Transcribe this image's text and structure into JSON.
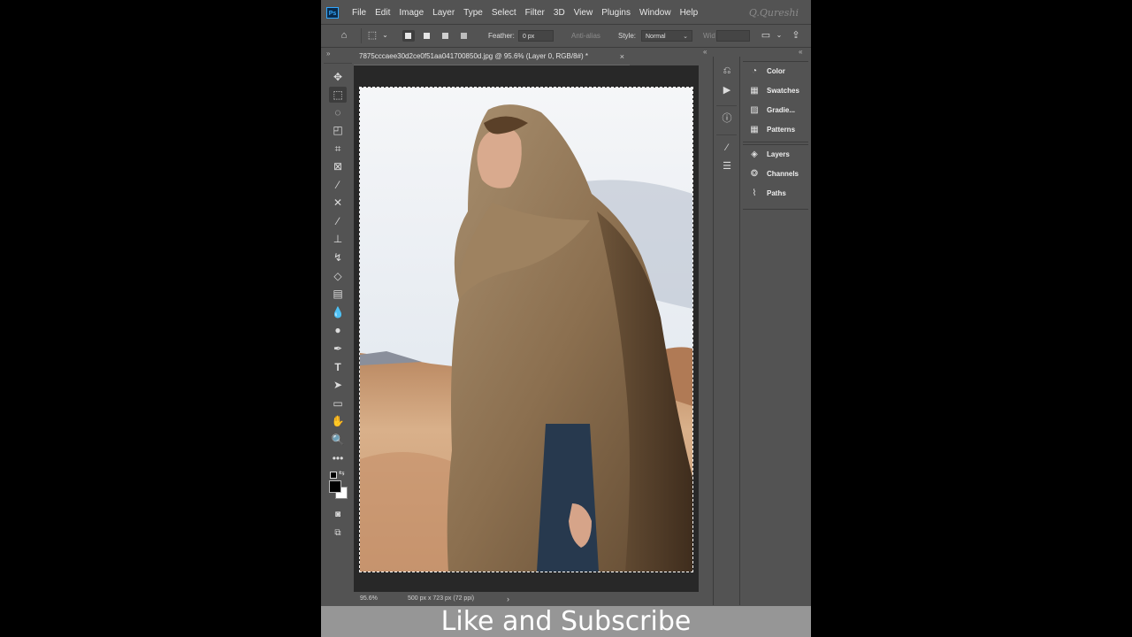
{
  "app": {
    "logo": "Ps",
    "watermark": "Q.Qureshi"
  },
  "menu": [
    "File",
    "Edit",
    "Image",
    "Layer",
    "Type",
    "Select",
    "Filter",
    "3D",
    "View",
    "Plugins",
    "Window",
    "Help"
  ],
  "options_bar": {
    "feather_label": "Feather:",
    "feather_value": "0 px",
    "anti_alias_label": "Anti-alias",
    "style_label": "Style:",
    "style_value": "Normal",
    "width_label": "Wid"
  },
  "document": {
    "tab_title": "7875cccaee30d2ce0f51aa041700850d.jpg @ 95.6% (Layer 0, RGB/8#) *",
    "close_glyph": "×"
  },
  "status_bar": {
    "zoom": "95.6%",
    "doc_info": "500 px x 723 px (72 ppi)",
    "arrow": "›"
  },
  "panels": [
    {
      "label": "Color",
      "icon": "color-palette-icon"
    },
    {
      "label": "Swatches",
      "icon": "swatches-grid-icon"
    },
    {
      "label": "Gradie...",
      "icon": "gradient-icon"
    },
    {
      "label": "Patterns",
      "icon": "patterns-grid-icon"
    },
    {
      "label": "Layers",
      "icon": "layers-stack-icon"
    },
    {
      "label": "Channels",
      "icon": "channels-icon"
    },
    {
      "label": "Paths",
      "icon": "paths-pen-icon"
    }
  ],
  "tools": [
    "move",
    "rectangular-marquee",
    "lasso",
    "object-selection",
    "crop",
    "frame",
    "eyedropper",
    "spot-healing",
    "brush",
    "clone-stamp",
    "history-brush",
    "eraser",
    "gradient",
    "blur",
    "dodge",
    "pen",
    "type",
    "path-selection",
    "rectangle",
    "hand",
    "zoom",
    "more",
    "default-colors",
    "foreground-background",
    "quick-mask",
    "screen-mode"
  ],
  "colors": {
    "foreground": "#000000",
    "background": "#ffffff",
    "ui": "#535353"
  },
  "banner": {
    "text": "Like and Subscribe"
  }
}
